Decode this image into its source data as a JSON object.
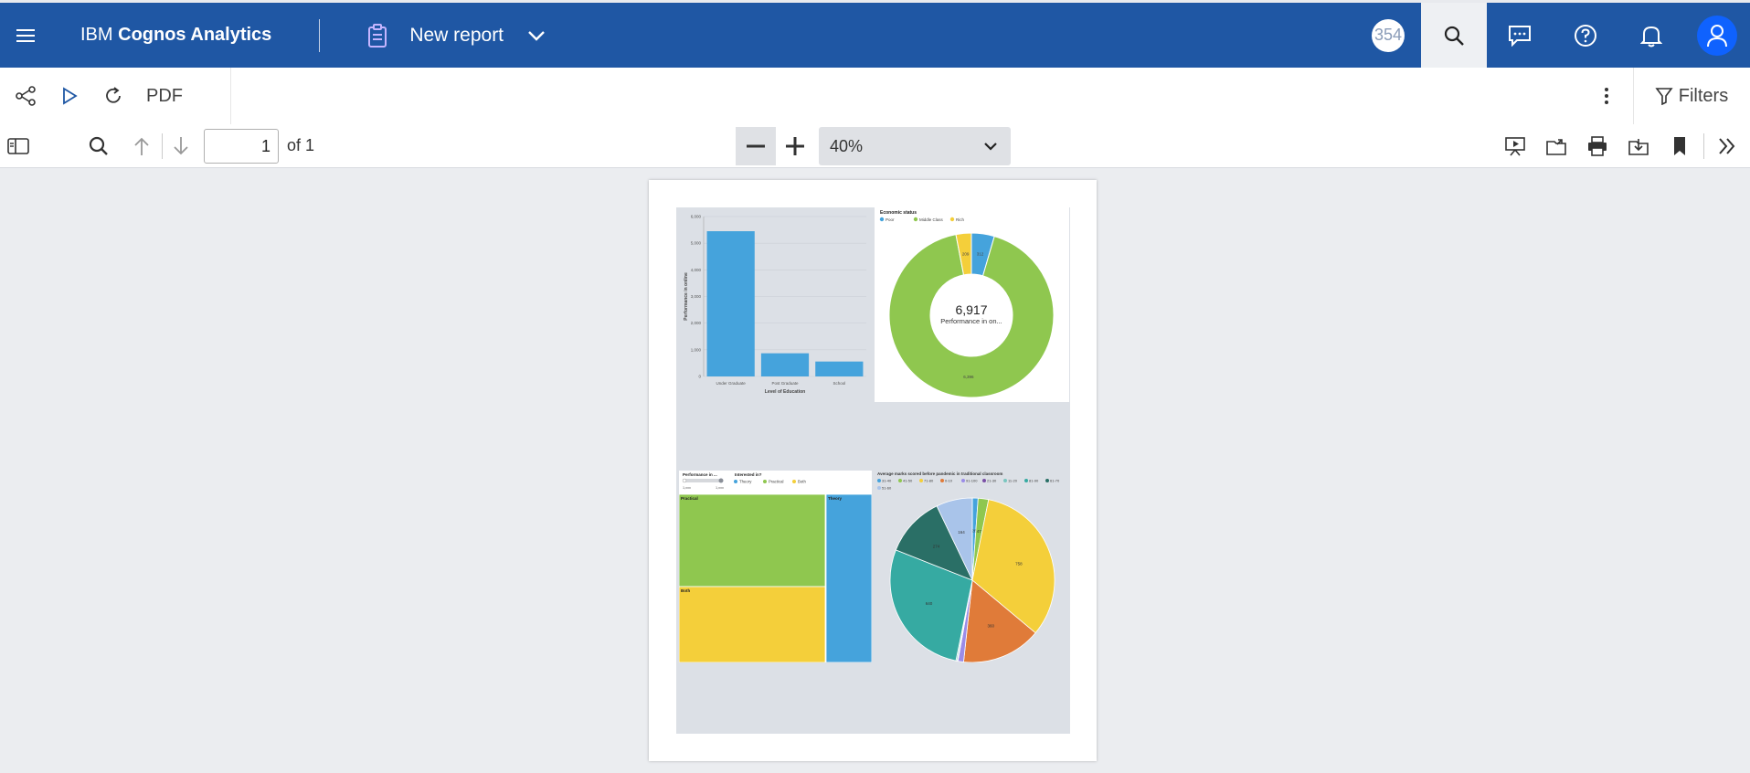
{
  "header": {
    "brand_prefix": "IBM ",
    "brand_name": "Cognos Analytics",
    "report_title": "New report",
    "counter": "354"
  },
  "toolbar": {
    "pdf_label": "PDF",
    "filters_label": "Filters"
  },
  "viewer": {
    "page_number": "1",
    "page_of": "of 1",
    "zoom": "40%"
  },
  "colors": {
    "brand_bar": "#1f57a4",
    "chart_blue": "#45a3dc",
    "chart_green": "#8fc74f",
    "chart_yellow": "#f4cf3a",
    "avatar": "#0f62fe"
  },
  "chart_data": [
    {
      "type": "bar",
      "categories": [
        "Under Graduate",
        "Post Graduate",
        "School"
      ],
      "values": [
        5450,
        870,
        560
      ],
      "ylabel": "Performance in online",
      "xlabel": "Level of Education",
      "ylim": [
        0,
        6000
      ],
      "yticks": [
        "0",
        "1,000",
        "2,000",
        "3,000",
        "4,000",
        "5,000",
        "6,000"
      ],
      "color": "#45a3dc"
    },
    {
      "type": "pie",
      "subtype": "donut",
      "title": "Economic status",
      "legend": [
        "Poor",
        "Middle Class",
        "Rich"
      ],
      "values": [
        312,
        6396,
        209
      ],
      "labels": [
        "312",
        "6,396",
        "209"
      ],
      "colors": [
        "#45a3dc",
        "#8fc74f",
        "#f4cf3a"
      ],
      "center_value": "6,917",
      "center_label": "Performance in on..."
    },
    {
      "type": "treemap",
      "title": "Performance in ...",
      "legend_title": "Interested in?",
      "legend": [
        "Theory",
        "Practical",
        "Both"
      ],
      "range_labels": [
        "1,xxx",
        "1,xxx"
      ],
      "items": [
        {
          "name": "Practical",
          "color": "#8fc74f"
        },
        {
          "name": "Both",
          "color": "#f4cf3a"
        },
        {
          "name": "Theory",
          "color": "#45a3dc"
        }
      ]
    },
    {
      "type": "pie",
      "title": "Average marks scored before pandemic in traditional classroom",
      "legend": [
        "31-40",
        "41-50",
        "71-80",
        "0-10",
        "91-100",
        "21-30",
        "11-20",
        "81-90",
        "61-70",
        "51-60"
      ],
      "values": [
        26,
        47,
        758,
        360,
        26,
        3,
        6,
        640,
        274,
        164
      ],
      "labels": [
        "26",
        "47",
        "758",
        "360",
        "",
        "",
        "",
        "640",
        "274",
        "164"
      ],
      "colors": [
        "#45a3dc",
        "#8fc74f",
        "#f4cf3a",
        "#e07b39",
        "#9b8ce8",
        "#7a4fa6",
        "#7ac6c0",
        "#36aaa2",
        "#2a6f66",
        "#a9c4ea"
      ]
    }
  ]
}
